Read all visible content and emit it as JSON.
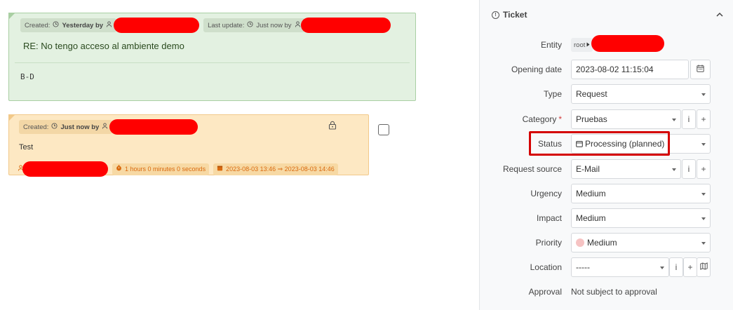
{
  "timeline": {
    "followup": {
      "created_label": "Created:",
      "created_time": "Yesterday by",
      "update_label": "Last update:",
      "update_time": "Just now by",
      "title": "RE: No tengo acceso al ambiente demo",
      "body": "B-D"
    },
    "task": {
      "created_label": "Created:",
      "created_time": "Just now by",
      "body": "Test",
      "duration": "1 hours 0 minutes 0 seconds",
      "schedule": "2023-08-03 13:46 ⇒ 2023-08-03 14:46"
    }
  },
  "panel": {
    "title": "Ticket",
    "fields": {
      "entity": {
        "label": "Entity",
        "value": "root"
      },
      "opening_date": {
        "label": "Opening date",
        "value": "2023-08-02 11:15:04"
      },
      "type": {
        "label": "Type",
        "value": "Request"
      },
      "category": {
        "label": "Category",
        "value": "Pruebas",
        "required": "*"
      },
      "status": {
        "label": "Status",
        "value": "Processing (planned)"
      },
      "request_source": {
        "label": "Request source",
        "value": "E-Mail"
      },
      "urgency": {
        "label": "Urgency",
        "value": "Medium"
      },
      "impact": {
        "label": "Impact",
        "value": "Medium"
      },
      "priority": {
        "label": "Priority",
        "value": "Medium"
      },
      "location": {
        "label": "Location",
        "value": "-----"
      },
      "approval": {
        "label": "Approval",
        "value": "Not subject to approval"
      }
    },
    "info_label": "i",
    "add_label": "+"
  },
  "colors": {
    "highlight": "#d40000",
    "priority_dot": "#f6c3c3",
    "redaction": "#ff0000"
  }
}
